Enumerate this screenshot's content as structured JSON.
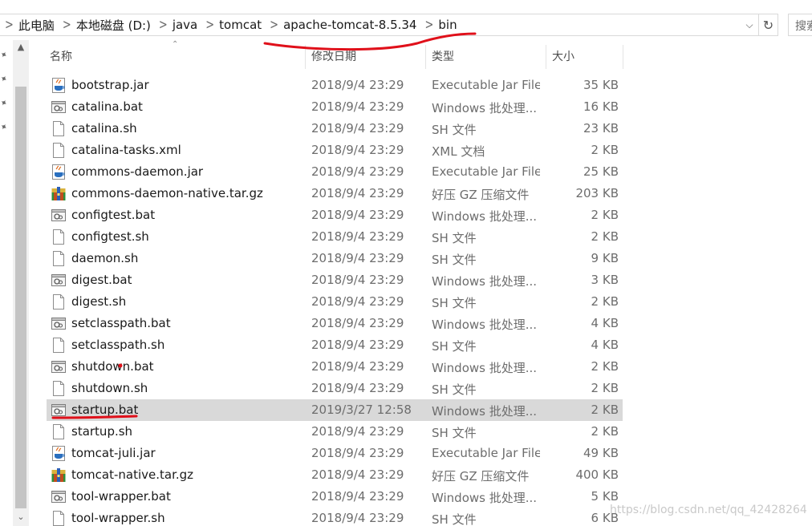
{
  "breadcrumb": [
    "此电脑",
    "本地磁盘 (D:)",
    "java",
    "tomcat",
    "apache-tomcat-8.5.34",
    "bin"
  ],
  "search": {
    "placeholder": "搜索"
  },
  "columns": {
    "name": "名称",
    "date": "修改日期",
    "type": "类型",
    "size": "大小"
  },
  "files": [
    {
      "name": "bootstrap.jar",
      "date": "2018/9/4 23:29",
      "type": "Executable Jar File",
      "size": "35 KB",
      "icon": "jar-file-icon"
    },
    {
      "name": "catalina.bat",
      "date": "2018/9/4 23:29",
      "type": "Windows 批处理...",
      "size": "16 KB",
      "icon": "bat-file-icon"
    },
    {
      "name": "catalina.sh",
      "date": "2018/9/4 23:29",
      "type": "SH 文件",
      "size": "23 KB",
      "icon": "blank-file-icon"
    },
    {
      "name": "catalina-tasks.xml",
      "date": "2018/9/4 23:29",
      "type": "XML 文档",
      "size": "2 KB",
      "icon": "blank-file-icon"
    },
    {
      "name": "commons-daemon.jar",
      "date": "2018/9/4 23:29",
      "type": "Executable Jar File",
      "size": "25 KB",
      "icon": "jar-file-icon"
    },
    {
      "name": "commons-daemon-native.tar.gz",
      "date": "2018/9/4 23:29",
      "type": "好压 GZ 压缩文件",
      "size": "203 KB",
      "icon": "archive-file-icon"
    },
    {
      "name": "configtest.bat",
      "date": "2018/9/4 23:29",
      "type": "Windows 批处理...",
      "size": "2 KB",
      "icon": "bat-file-icon"
    },
    {
      "name": "configtest.sh",
      "date": "2018/9/4 23:29",
      "type": "SH 文件",
      "size": "2 KB",
      "icon": "blank-file-icon"
    },
    {
      "name": "daemon.sh",
      "date": "2018/9/4 23:29",
      "type": "SH 文件",
      "size": "9 KB",
      "icon": "blank-file-icon"
    },
    {
      "name": "digest.bat",
      "date": "2018/9/4 23:29",
      "type": "Windows 批处理...",
      "size": "3 KB",
      "icon": "bat-file-icon"
    },
    {
      "name": "digest.sh",
      "date": "2018/9/4 23:29",
      "type": "SH 文件",
      "size": "2 KB",
      "icon": "blank-file-icon"
    },
    {
      "name": "setclasspath.bat",
      "date": "2018/9/4 23:29",
      "type": "Windows 批处理...",
      "size": "4 KB",
      "icon": "bat-file-icon"
    },
    {
      "name": "setclasspath.sh",
      "date": "2018/9/4 23:29",
      "type": "SH 文件",
      "size": "4 KB",
      "icon": "blank-file-icon"
    },
    {
      "name": "shutdown.bat",
      "date": "2018/9/4 23:29",
      "type": "Windows 批处理...",
      "size": "2 KB",
      "icon": "bat-file-icon"
    },
    {
      "name": "shutdown.sh",
      "date": "2018/9/4 23:29",
      "type": "SH 文件",
      "size": "2 KB",
      "icon": "blank-file-icon"
    },
    {
      "name": "startup.bat",
      "date": "2019/3/27 12:58",
      "type": "Windows 批处理...",
      "size": "2 KB",
      "icon": "bat-file-icon",
      "selected": true
    },
    {
      "name": "startup.sh",
      "date": "2018/9/4 23:29",
      "type": "SH 文件",
      "size": "2 KB",
      "icon": "blank-file-icon"
    },
    {
      "name": "tomcat-juli.jar",
      "date": "2018/9/4 23:29",
      "type": "Executable Jar File",
      "size": "49 KB",
      "icon": "jar-file-icon"
    },
    {
      "name": "tomcat-native.tar.gz",
      "date": "2018/9/4 23:29",
      "type": "好压 GZ 压缩文件",
      "size": "400 KB",
      "icon": "archive-file-icon"
    },
    {
      "name": "tool-wrapper.bat",
      "date": "2018/9/4 23:29",
      "type": "Windows 批处理...",
      "size": "5 KB",
      "icon": "bat-file-icon"
    },
    {
      "name": "tool-wrapper.sh",
      "date": "2018/9/4 23:29",
      "type": "SH 文件",
      "size": "6 KB",
      "icon": "blank-file-icon"
    }
  ],
  "watermark": "https://blog.csdn.net/qq_42428264",
  "colors": {
    "annotation_red": "#e0101a",
    "selected_row": "#d9d9d9"
  }
}
